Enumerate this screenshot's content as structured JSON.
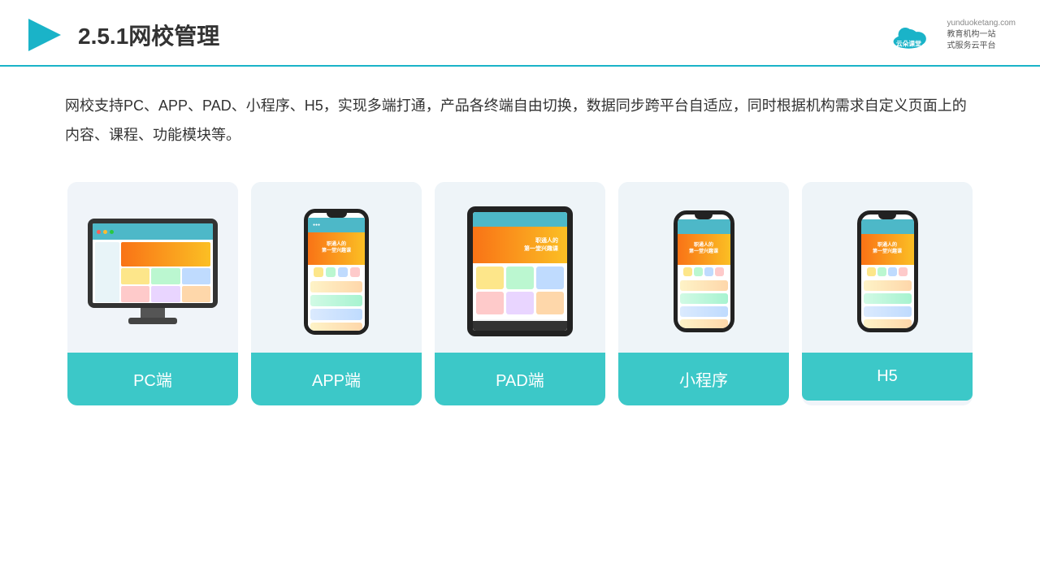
{
  "header": {
    "title": "2.5.1网校管理",
    "logo_name": "云朵课堂",
    "logo_url": "yunduoketang.com",
    "logo_slogan": "教育机构一站\n式服务云平台"
  },
  "description": {
    "text": "网校支持PC、APP、PAD、小程序、H5，实现多端打通，产品各终端自由切换，数据同步跨平台自适应，同时根据机构需求自定义页面上的内容、课程、功能模块等。"
  },
  "cards": [
    {
      "label": "PC端"
    },
    {
      "label": "APP端"
    },
    {
      "label": "PAD端"
    },
    {
      "label": "小程序"
    },
    {
      "label": "H5"
    }
  ]
}
